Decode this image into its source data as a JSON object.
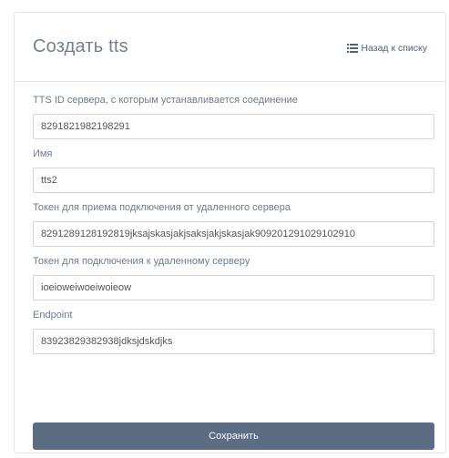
{
  "header": {
    "title": "Создать tts",
    "back_link": "Назад к списку"
  },
  "form": {
    "fields": [
      {
        "label": "TTS ID сервера, с которым устанавливается соединение",
        "value": "8291821982198291"
      },
      {
        "label": "Имя",
        "value": "tts2"
      },
      {
        "label": "Токен для приема подключения от удаленного сервера",
        "value": "8291289128192819jksajskasjakjsaksjakjskasjak909201291029102910"
      },
      {
        "label": "Токен для подключения к удаленному серверу",
        "value": "ioeioweiwoeiwoieow"
      },
      {
        "label": "Endpoint",
        "value": "83923829382938jdksjdskdjks"
      }
    ],
    "submit_label": "Сохранить"
  },
  "colors": {
    "title": "#72808e",
    "label": "#6b7c8d",
    "button": "#5c6c82",
    "border": "#d4d4d4"
  }
}
